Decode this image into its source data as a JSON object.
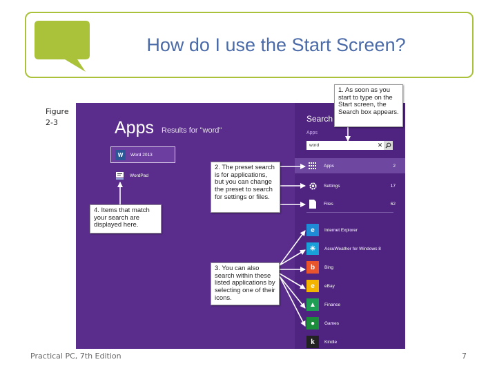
{
  "slide": {
    "title": "How do I use the Start Screen?",
    "figure_label": "Figure 2-3",
    "footer_left": "Practical PC, 7th Edition",
    "page_number": "7",
    "accent_color": "#a9c23a",
    "title_color": "#4a6aa8"
  },
  "apps_panel": {
    "heading": "Apps",
    "subheading": "Results for \"word\"",
    "results": [
      {
        "label": "Word 2013",
        "icon": "word-icon",
        "icon_text": "W"
      },
      {
        "label": "WordPad",
        "icon": "wordpad-icon",
        "icon_text": ""
      }
    ]
  },
  "search_panel": {
    "heading": "Search",
    "scope": "Apps",
    "query": "word",
    "clear_glyph": "✕",
    "scopes": [
      {
        "label": "Apps",
        "count": "2",
        "icon": "apps-grid-icon"
      },
      {
        "label": "Settings",
        "count": "17",
        "icon": "settings-gear-icon"
      },
      {
        "label": "Files",
        "count": "62",
        "icon": "files-icon"
      }
    ],
    "apps": [
      {
        "label": "Internet Explorer",
        "icon": "internet-explorer-icon",
        "icon_text": "e",
        "color": "#1f8ad6"
      },
      {
        "label": "AccuWeather for Windows 8",
        "icon": "accuweather-icon",
        "icon_text": "☀",
        "color": "#1aa0d8"
      },
      {
        "label": "Bing",
        "icon": "bing-icon",
        "icon_text": "b",
        "color": "#e8542c"
      },
      {
        "label": "eBay",
        "icon": "ebay-icon",
        "icon_text": "e",
        "color": "#f2b400"
      },
      {
        "label": "Finance",
        "icon": "finance-icon",
        "icon_text": "▲",
        "color": "#1e9e54"
      },
      {
        "label": "Games",
        "icon": "games-icon",
        "icon_text": "●",
        "color": "#1a8c3a"
      },
      {
        "label": "Kindle",
        "icon": "kindle-icon",
        "icon_text": "k",
        "color": "#222222"
      }
    ]
  },
  "callouts": {
    "c1": "1. As soon as you start to type on the Start screen, the Search box appears.",
    "c2": "2. The preset search is for applications, but you can change the preset to search for settings or files.",
    "c3": "3. You can also search within these listed applications by selecting one of their icons.",
    "c4": "4. Items that match your search are displayed here."
  }
}
